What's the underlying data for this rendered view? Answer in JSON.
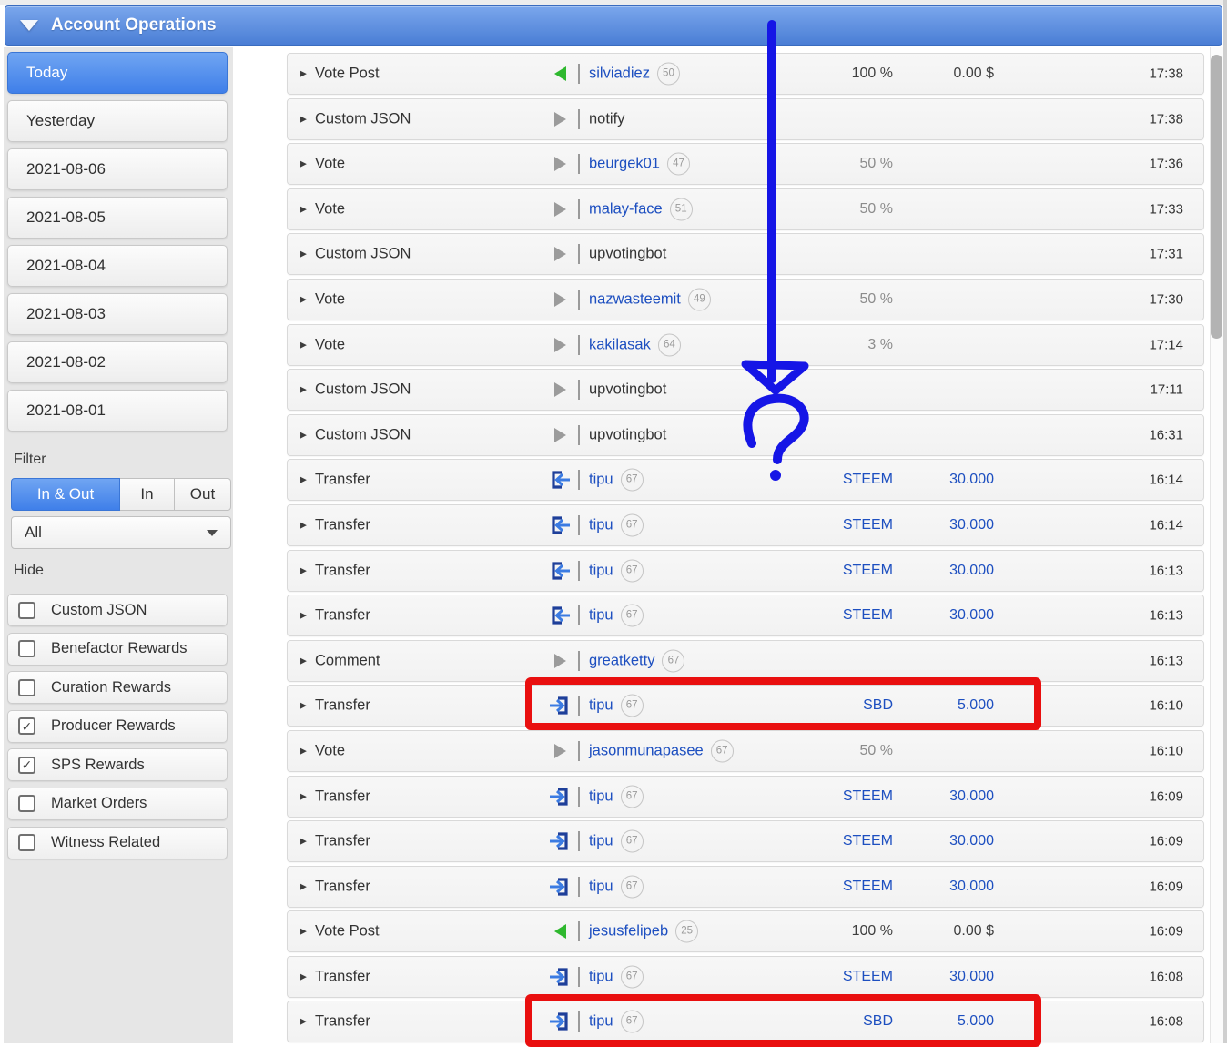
{
  "header": {
    "title": "Account Operations"
  },
  "sidebar": {
    "date_buttons": [
      {
        "label": "Today",
        "selected": true
      },
      {
        "label": "Yesterday",
        "selected": false
      },
      {
        "label": "2021-08-06",
        "selected": false
      },
      {
        "label": "2021-08-05",
        "selected": false
      },
      {
        "label": "2021-08-04",
        "selected": false
      },
      {
        "label": "2021-08-03",
        "selected": false
      },
      {
        "label": "2021-08-02",
        "selected": false
      },
      {
        "label": "2021-08-01",
        "selected": false
      }
    ],
    "filter_label": "Filter",
    "direction_buttons": [
      {
        "label": "In & Out",
        "selected": true
      },
      {
        "label": "In",
        "selected": false
      },
      {
        "label": "Out",
        "selected": false
      }
    ],
    "type_dropdown_value": "All",
    "hide_label": "Hide",
    "hide_options": [
      {
        "label": "Custom JSON",
        "checked": false
      },
      {
        "label": "Benefactor Rewards",
        "checked": false
      },
      {
        "label": "Curation Rewards",
        "checked": false
      },
      {
        "label": "Producer Rewards",
        "checked": true
      },
      {
        "label": "SPS Rewards",
        "checked": true
      },
      {
        "label": "Market Orders",
        "checked": false
      },
      {
        "label": "Witness Related",
        "checked": false
      }
    ]
  },
  "operations": [
    {
      "type": "Vote Post",
      "icon": "vote-post",
      "account": "silviadiez",
      "rep": "50",
      "account_link": true,
      "mid": "100 %",
      "mid_class": "dark",
      "amount": "0.00 $",
      "amount_class": "dark",
      "time": "17:38",
      "highlighted": false
    },
    {
      "type": "Custom JSON",
      "icon": "generic",
      "account": "notify",
      "rep": null,
      "account_link": false,
      "mid": "",
      "mid_class": "",
      "amount": "",
      "amount_class": "",
      "time": "17:38",
      "highlighted": false
    },
    {
      "type": "Vote",
      "icon": "generic",
      "account": "beurgek01",
      "rep": "47",
      "account_link": true,
      "mid": "50 %",
      "mid_class": "muted",
      "amount": "",
      "amount_class": "",
      "time": "17:36",
      "highlighted": false
    },
    {
      "type": "Vote",
      "icon": "generic",
      "account": "malay-face",
      "rep": "51",
      "account_link": true,
      "mid": "50 %",
      "mid_class": "muted",
      "amount": "",
      "amount_class": "",
      "time": "17:33",
      "highlighted": false
    },
    {
      "type": "Custom JSON",
      "icon": "generic",
      "account": "upvotingbot",
      "rep": null,
      "account_link": false,
      "mid": "",
      "mid_class": "",
      "amount": "",
      "amount_class": "",
      "time": "17:31",
      "highlighted": false
    },
    {
      "type": "Vote",
      "icon": "generic",
      "account": "nazwasteemit",
      "rep": "49",
      "account_link": true,
      "mid": "50 %",
      "mid_class": "muted",
      "amount": "",
      "amount_class": "",
      "time": "17:30",
      "highlighted": false
    },
    {
      "type": "Vote",
      "icon": "generic",
      "account": "kakilasak",
      "rep": "64",
      "account_link": true,
      "mid": "3 %",
      "mid_class": "muted",
      "amount": "",
      "amount_class": "",
      "time": "17:14",
      "highlighted": false
    },
    {
      "type": "Custom JSON",
      "icon": "generic",
      "account": "upvotingbot",
      "rep": null,
      "account_link": false,
      "mid": "",
      "mid_class": "",
      "amount": "",
      "amount_class": "",
      "time": "17:11",
      "highlighted": false
    },
    {
      "type": "Custom JSON",
      "icon": "generic",
      "account": "upvotingbot",
      "rep": null,
      "account_link": false,
      "mid": "",
      "mid_class": "",
      "amount": "",
      "amount_class": "",
      "time": "16:31",
      "highlighted": false
    },
    {
      "type": "Transfer",
      "icon": "transfer-in",
      "account": "tipu",
      "rep": "67",
      "account_link": true,
      "mid": "STEEM",
      "mid_class": "link",
      "amount": "30.000",
      "amount_class": "link",
      "time": "16:14",
      "highlighted": false
    },
    {
      "type": "Transfer",
      "icon": "transfer-in",
      "account": "tipu",
      "rep": "67",
      "account_link": true,
      "mid": "STEEM",
      "mid_class": "link",
      "amount": "30.000",
      "amount_class": "link",
      "time": "16:14",
      "highlighted": false
    },
    {
      "type": "Transfer",
      "icon": "transfer-in",
      "account": "tipu",
      "rep": "67",
      "account_link": true,
      "mid": "STEEM",
      "mid_class": "link",
      "amount": "30.000",
      "amount_class": "link",
      "time": "16:13",
      "highlighted": false
    },
    {
      "type": "Transfer",
      "icon": "transfer-in",
      "account": "tipu",
      "rep": "67",
      "account_link": true,
      "mid": "STEEM",
      "mid_class": "link",
      "amount": "30.000",
      "amount_class": "link",
      "time": "16:13",
      "highlighted": false
    },
    {
      "type": "Comment",
      "icon": "generic",
      "account": "greatketty",
      "rep": "67",
      "account_link": true,
      "mid": "",
      "mid_class": "",
      "amount": "",
      "amount_class": "",
      "time": "16:13",
      "highlighted": false
    },
    {
      "type": "Transfer",
      "icon": "transfer-out",
      "account": "tipu",
      "rep": "67",
      "account_link": true,
      "mid": "SBD",
      "mid_class": "link",
      "amount": "5.000",
      "amount_class": "link",
      "time": "16:10",
      "highlighted": true
    },
    {
      "type": "Vote",
      "icon": "generic",
      "account": "jasonmunapasee",
      "rep": "67",
      "account_link": true,
      "mid": "50 %",
      "mid_class": "muted",
      "amount": "",
      "amount_class": "",
      "time": "16:10",
      "highlighted": false
    },
    {
      "type": "Transfer",
      "icon": "transfer-out",
      "account": "tipu",
      "rep": "67",
      "account_link": true,
      "mid": "STEEM",
      "mid_class": "link",
      "amount": "30.000",
      "amount_class": "link",
      "time": "16:09",
      "highlighted": false
    },
    {
      "type": "Transfer",
      "icon": "transfer-out",
      "account": "tipu",
      "rep": "67",
      "account_link": true,
      "mid": "STEEM",
      "mid_class": "link",
      "amount": "30.000",
      "amount_class": "link",
      "time": "16:09",
      "highlighted": false
    },
    {
      "type": "Transfer",
      "icon": "transfer-out",
      "account": "tipu",
      "rep": "67",
      "account_link": true,
      "mid": "STEEM",
      "mid_class": "link",
      "amount": "30.000",
      "amount_class": "link",
      "time": "16:09",
      "highlighted": false
    },
    {
      "type": "Vote Post",
      "icon": "vote-post",
      "account": "jesusfelipeb",
      "rep": "25",
      "account_link": true,
      "mid": "100 %",
      "mid_class": "dark",
      "amount": "0.00 $",
      "amount_class": "dark",
      "time": "16:09",
      "highlighted": false
    },
    {
      "type": "Transfer",
      "icon": "transfer-out",
      "account": "tipu",
      "rep": "67",
      "account_link": true,
      "mid": "STEEM",
      "mid_class": "link",
      "amount": "30.000",
      "amount_class": "link",
      "time": "16:08",
      "highlighted": false
    },
    {
      "type": "Transfer",
      "icon": "transfer-out",
      "account": "tipu",
      "rep": "67",
      "account_link": true,
      "mid": "SBD",
      "mid_class": "link",
      "amount": "5.000",
      "amount_class": "link",
      "time": "16:08",
      "highlighted": true
    }
  ],
  "annotations": {
    "question_mark_text": "?",
    "arrow_color": "#1515e6",
    "highlight_box_color": "#e90f0f"
  },
  "colors": {
    "header_blue_top": "#7aa6ec",
    "header_blue_bottom": "#4a7ed5",
    "selected_blue_top": "#70a5f2",
    "selected_blue_bottom": "#3f7fe9",
    "link_blue": "#1d4fc0",
    "vote_post_green": "#2eb82e",
    "transfer_bracket_blue": "#1e3f9a",
    "transfer_arrow_blue": "#3b7be2"
  }
}
